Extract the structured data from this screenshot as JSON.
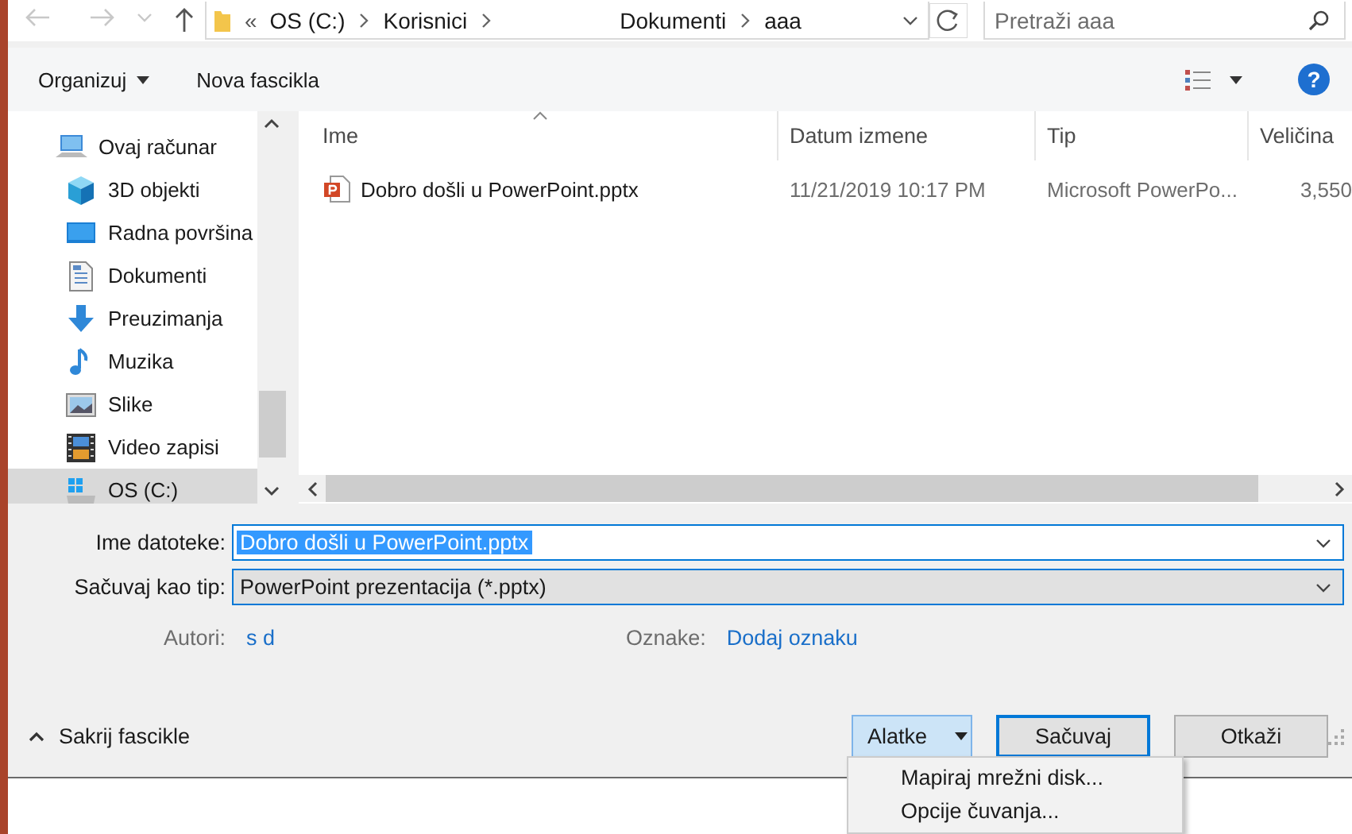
{
  "navigation": {
    "buttons": [
      {
        "kind": "back",
        "disabled": true
      },
      {
        "kind": "forward",
        "disabled": true
      },
      {
        "kind": "recent",
        "disabled": true
      },
      {
        "kind": "up",
        "disabled": false
      }
    ],
    "overflow": "«",
    "breadcrumbs": [
      "OS (C:)",
      "Korisnici",
      "Dokumenti",
      "aaa"
    ],
    "search": {
      "placeholder": "Pretraži aaa"
    }
  },
  "toolbar": {
    "items": [
      {
        "label": "Organizuj",
        "dropdown": true
      },
      {
        "label": "Nova fascikla",
        "dropdown": false
      }
    ],
    "help": "?"
  },
  "sidebar": {
    "items": [
      {
        "label": "Ovaj računar",
        "kind": "computer",
        "selected": false,
        "children": [
          {
            "label": "3D objekti",
            "kind": "cube",
            "selected": false
          },
          {
            "label": "Radna površina",
            "kind": "desktop",
            "selected": false
          },
          {
            "label": "Dokumenti",
            "kind": "document",
            "selected": false
          },
          {
            "label": "Preuzimanja",
            "kind": "download",
            "selected": false
          },
          {
            "label": "Muzika",
            "kind": "music",
            "selected": false
          },
          {
            "label": "Slike",
            "kind": "picture",
            "selected": false
          },
          {
            "label": "Video zapisi",
            "kind": "film",
            "selected": false
          },
          {
            "label": "OS (C:)",
            "kind": "drive",
            "selected": true
          }
        ]
      }
    ]
  },
  "table": {
    "columns": [
      {
        "label": "Ime",
        "sorted": true
      },
      {
        "label": "Datum izmene",
        "sorted": false
      },
      {
        "label": "Tip",
        "sorted": false
      },
      {
        "label": "Veličina",
        "sorted": false
      }
    ],
    "rows": [
      {
        "name": "Dobro došli u PowerPoint.pptx",
        "date": "11/21/2019 10:17 PM",
        "type": "Microsoft PowerPo...",
        "size": "3,550"
      }
    ]
  },
  "form": {
    "file_name": {
      "label": "Ime datoteke:",
      "value": "Dobro došli u PowerPoint.pptx",
      "text_selected": true
    },
    "save_type": {
      "label": "Sačuvaj kao tip:",
      "value": "PowerPoint prezentacija (*.pptx)"
    },
    "authors": {
      "label": "Autori:",
      "value": "s d"
    },
    "tags": {
      "label": "Oznake:",
      "value": "Dodaj oznaku"
    }
  },
  "footer": {
    "hide_folders": "Sakrij fascikle",
    "buttons": [
      {
        "label": "Alatke",
        "kind": "dropdown",
        "pressed": true,
        "focused": false
      },
      {
        "label": "Sačuvaj",
        "kind": "plain",
        "pressed": false,
        "focused": true
      },
      {
        "label": "Otkaži",
        "kind": "plain",
        "pressed": false,
        "focused": false
      }
    ]
  },
  "menu": {
    "items": [
      "Mapiraj mrežni disk...",
      "Opcije čuvanja..."
    ]
  }
}
